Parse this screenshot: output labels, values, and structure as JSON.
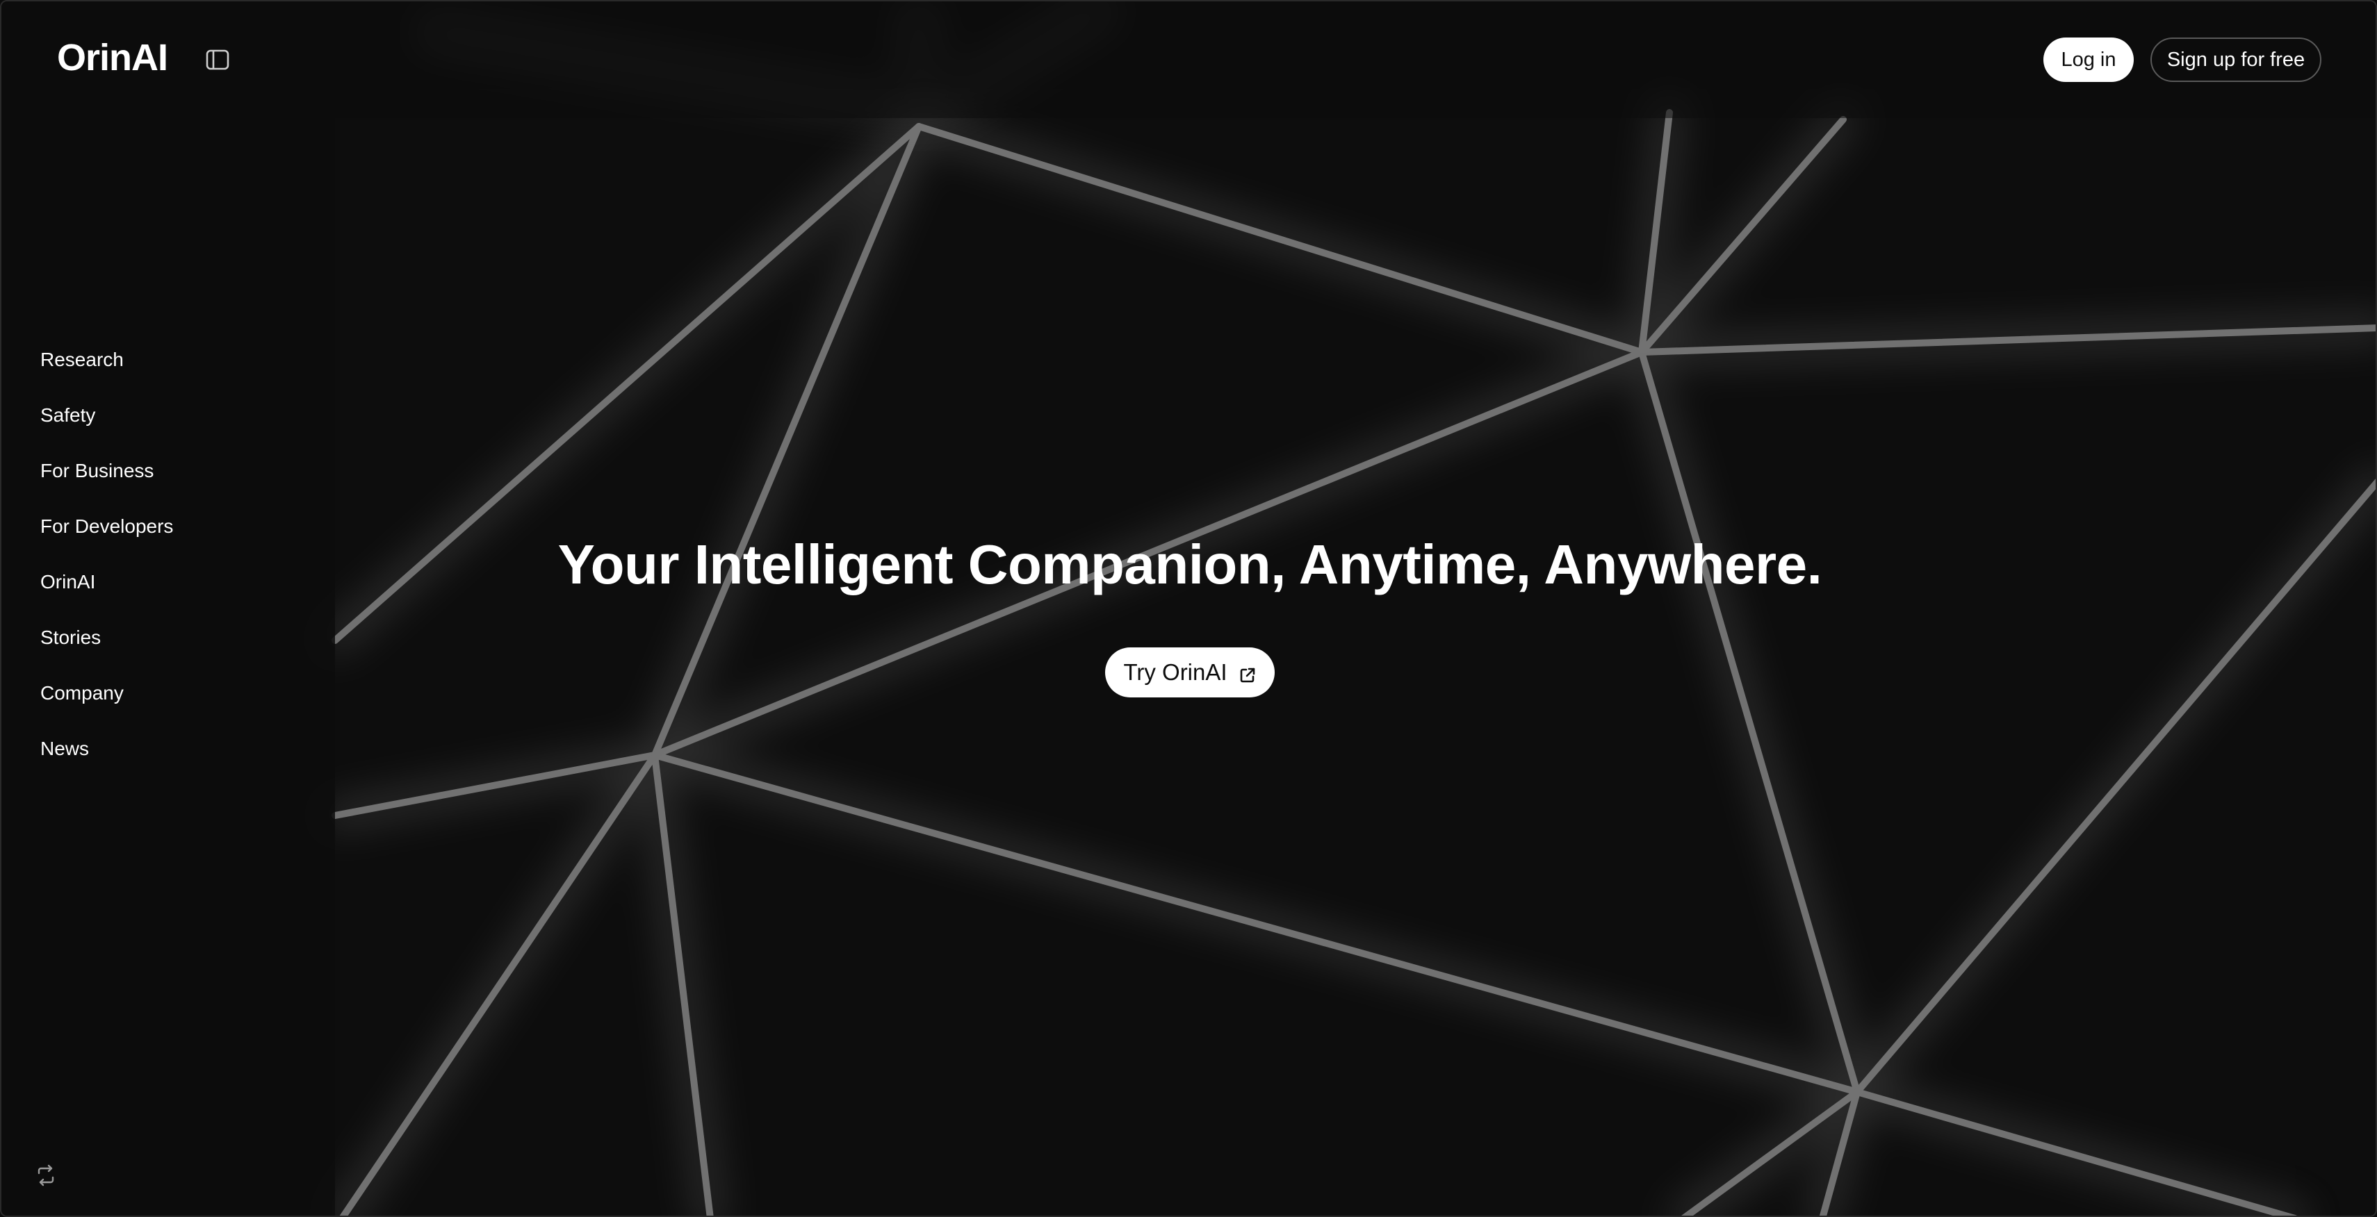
{
  "header": {
    "logo": "OrinAI",
    "sidebar_toggle_icon": "sidebar-toggle-icon",
    "login_label": "Log in",
    "signup_label": "Sign up for free"
  },
  "sidebar": {
    "items": [
      {
        "label": "Research"
      },
      {
        "label": "Safety"
      },
      {
        "label": "For Business"
      },
      {
        "label": "For Developers"
      },
      {
        "label": "OrinAI"
      },
      {
        "label": "Stories"
      },
      {
        "label": "Company"
      },
      {
        "label": "News"
      }
    ],
    "footer_icon": "refresh-icon"
  },
  "hero": {
    "title": "Your Intelligent Companion, Anytime, Anywhere.",
    "cta_label": "Try OrinAI",
    "cta_icon": "external-link-icon"
  },
  "colors": {
    "background": "#0d0d0d",
    "text": "#ffffff",
    "accent_button": "#ffffff"
  }
}
